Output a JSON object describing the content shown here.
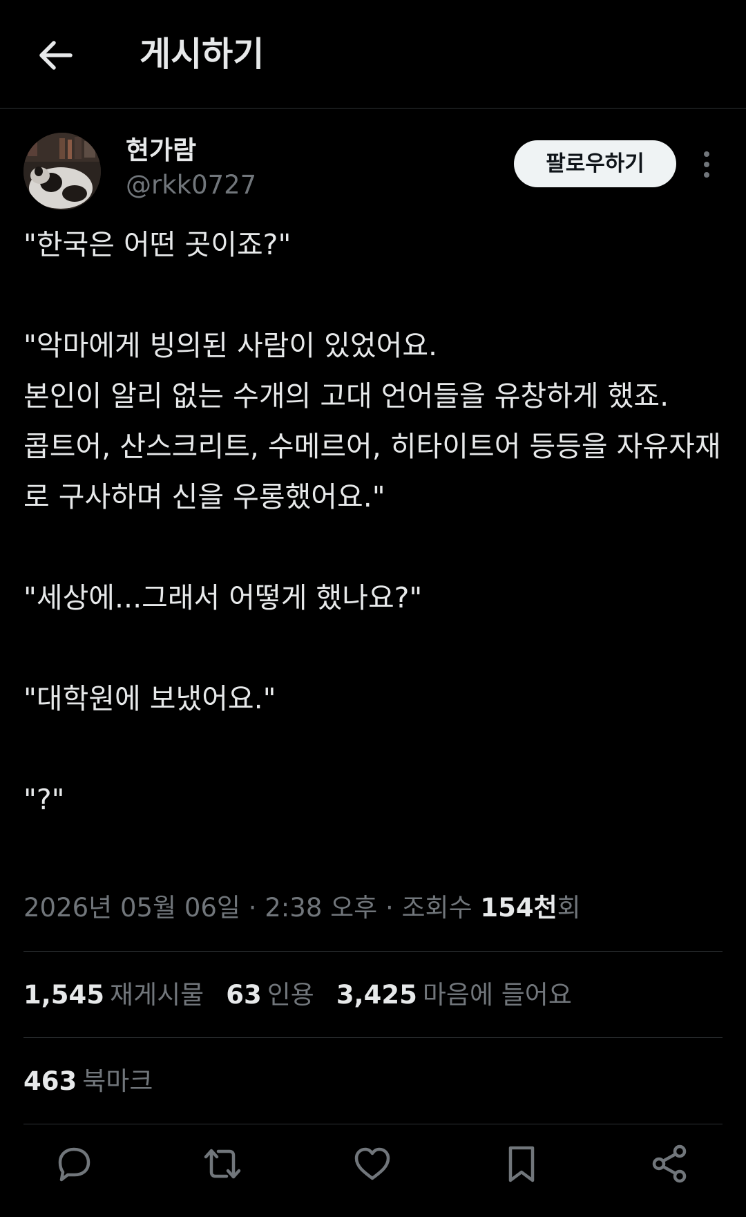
{
  "header": {
    "title": "게시하기",
    "back_icon": "arrow-left-icon"
  },
  "author": {
    "display_name": "현가람",
    "handle": "@rkk0727",
    "follow_label": "팔로우하기",
    "more_icon": "more-vertical-icon"
  },
  "tweet": {
    "text": "\"한국은 어떤 곳이죠?\"\n\n\"악마에게 빙의된 사람이 있었어요.\n본인이 알리 없는 수개의 고대 언어들을 유창하게 했죠.\n콥트어, 산스크리트, 수메르어, 히타이트어 등등을 자유자재로 구사하며 신을 우롱했어요.\"\n\n\"세상에...그래서 어떻게 했나요?\"\n\n\"대학원에 보냈어요.\"\n\n\"?\""
  },
  "meta": {
    "date": "2026년 05월 06일",
    "sep1": " · ",
    "time": "2:38 오후",
    "sep2": " · ",
    "views_label": "조회수 ",
    "views_number": "154천",
    "views_suffix": "회"
  },
  "stats": {
    "reposts_count": "1,545",
    "reposts_label": "재게시물",
    "quotes_count": "63",
    "quotes_label": "인용",
    "likes_count": "3,425",
    "likes_label": "마음에 들어요",
    "bookmarks_count": "463",
    "bookmarks_label": "북마크"
  },
  "actions": {
    "reply_icon": "reply-icon",
    "repost_icon": "repost-icon",
    "like_icon": "heart-icon",
    "bookmark_icon": "bookmark-icon",
    "share_icon": "share-icon"
  },
  "colors": {
    "background": "#000000",
    "text_primary": "#e7e9ea",
    "text_secondary": "#71767b",
    "divider": "#2f3336",
    "follow_button_bg": "#eff3f4"
  }
}
